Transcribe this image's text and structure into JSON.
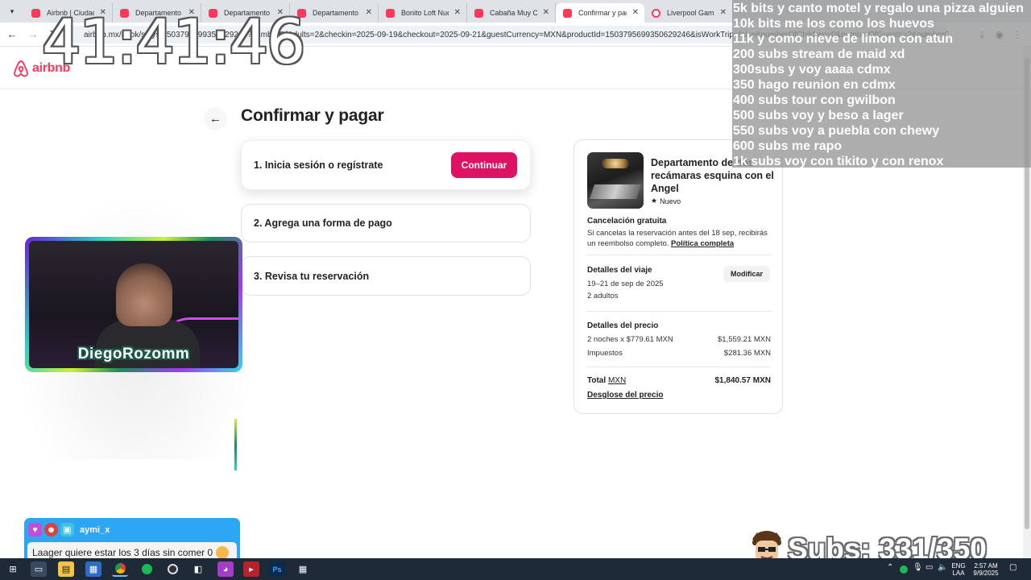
{
  "tabs": [
    {
      "title": "Airbnb | Ciudad de",
      "active": false
    },
    {
      "title": "Departamento cé",
      "active": false
    },
    {
      "title": "Departamento de",
      "active": false
    },
    {
      "title": "Departamento de",
      "active": false
    },
    {
      "title": "Bonito Loft Nuev",
      "active": false
    },
    {
      "title": "Cabaña Muy Com",
      "active": false
    },
    {
      "title": "Confirmar y pagar",
      "active": true
    },
    {
      "title": "Liverpool Gaming",
      "active": false
    }
  ],
  "address": {
    "url": "airbnb.mx/book/stays/1503795699350629246?numberOfAdults=2&checkin=2025-09-19&checkout=2025-09-21&guestCurrency=MXN&productId=1503795699350629246&isWorkTrip=false&numberOfChildren=0&numberOfGuests=2&numberOfI"
  },
  "header": {
    "logo_text": "airbnb"
  },
  "main": {
    "title": "Confirmar y pagar",
    "steps": [
      {
        "label": "1. Inicia sesión o regístrate",
        "button": "Continuar"
      },
      {
        "label": "2. Agrega una forma de pago"
      },
      {
        "label": "3. Revisa tu reservación"
      }
    ]
  },
  "summary": {
    "property_title": "Departamento de dos recámaras esquina con el Angel",
    "badge": "Nuevo",
    "cancellation_title": "Cancelación gratuita",
    "cancellation_text": "Si cancelas la reservación antes del 18 sep, recibirás un reembolso completo.",
    "cancellation_link": "Política completa",
    "trip_title": "Detalles del viaje",
    "dates": "19–21 de sep de 2025",
    "guests": "2 adultos",
    "modify_label": "Modificar",
    "price_title": "Detalles del precio",
    "nights_label": "2 noches x $779.61 MXN",
    "nights_value": "$1,559.21 MXN",
    "taxes_label": "Impuestos",
    "taxes_value": "$281.36 MXN",
    "total_label": "Total",
    "total_currency": "MXN",
    "total_value": "$1,840.57 MXN",
    "breakdown_link": "Desglose del precio"
  },
  "overlay": {
    "timer": "41:41:46",
    "goals": [
      "5k bits y canto motel y regalo una pizza alguien",
      "10k bits me los como los huevos",
      "11k y como nieve de limon con atun",
      "200 subs stream de maid xd",
      "300subs y voy aaaa cdmx",
      "350 hago reunion en cdmx",
      "400 subs tour con gwilbon",
      "500 subs voy y beso a lager",
      "550 subs voy a puebla con chewy",
      "600 subs me rapo",
      "1k subs voy con tikito y con renox"
    ],
    "streamer_name": "DiegoRozomm",
    "chat_user": "aymi_x",
    "chat_message": "Laager quiere estar los 3 días sin comer 0",
    "subs": "Subs: 331/350"
  },
  "taskbar": {
    "lang": "ENG",
    "region": "LAA",
    "time": "2:57 AM",
    "date": "9/9/2025"
  },
  "colors": {
    "brand": "#ff385c",
    "primary_button": "#de1162",
    "chat_bg": "#2da7f3"
  }
}
